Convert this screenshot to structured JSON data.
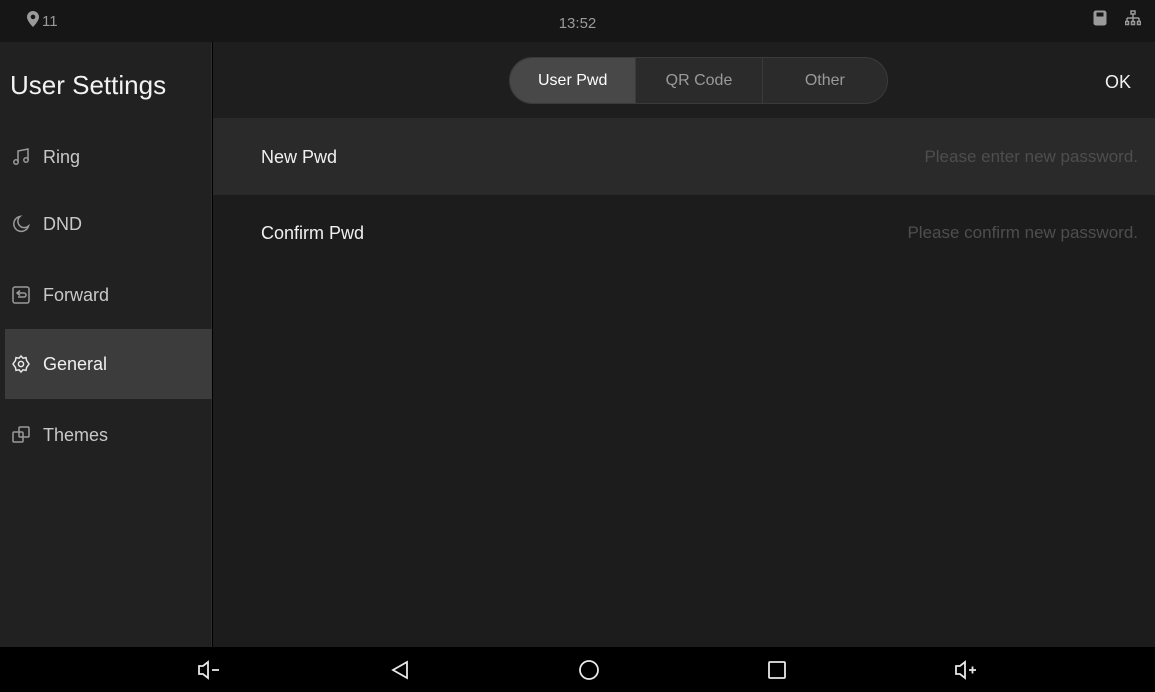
{
  "status": {
    "location_badge": "11",
    "time": "13:52"
  },
  "sidebar": {
    "title": "User Settings",
    "items": [
      {
        "label": "Ring",
        "icon": "music-note-icon",
        "active": false
      },
      {
        "label": "DND",
        "icon": "moon-icon",
        "active": false
      },
      {
        "label": "Forward",
        "icon": "forward-icon",
        "active": false
      },
      {
        "label": "General",
        "icon": "gear-icon",
        "active": true
      },
      {
        "label": "Themes",
        "icon": "themes-icon",
        "active": false
      }
    ]
  },
  "header": {
    "tabs": [
      {
        "label": "User Pwd",
        "active": true
      },
      {
        "label": "QR Code",
        "active": false
      },
      {
        "label": "Other",
        "active": false
      }
    ],
    "ok_label": "OK"
  },
  "form": {
    "new_pwd_label": "New Pwd",
    "new_pwd_placeholder": "Please enter new password.",
    "confirm_pwd_label": "Confirm Pwd",
    "confirm_pwd_placeholder": "Please confirm new password."
  },
  "navbar": {
    "buttons": [
      "volume-down-icon",
      "back-icon",
      "home-icon",
      "recents-icon",
      "volume-up-icon"
    ]
  },
  "colors": {
    "background": "#1c1c1c",
    "sidebar": "#212121",
    "active_item": "#3c3c3c",
    "active_tab": "#484848",
    "placeholder": "#4e4e4e"
  }
}
